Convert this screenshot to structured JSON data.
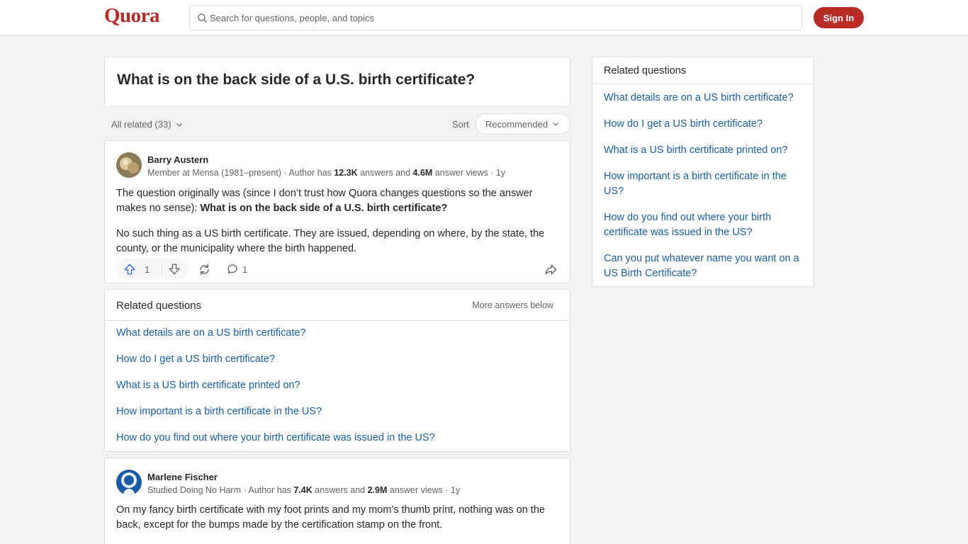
{
  "header": {
    "logo": "Quora",
    "search_placeholder": "Search for questions, people, and topics",
    "signin_label": "Sign In",
    "brand_color": "#b92b27"
  },
  "question": {
    "title": "What is on the back side of a U.S. birth certificate?"
  },
  "filters": {
    "all_related": "All related (33)",
    "sort_label": "Sort",
    "sort_value": "Recommended"
  },
  "answers": [
    {
      "author": "Barry Austern",
      "cred_prefix": "Member at Mensa (1981–present) · Author has ",
      "answers_count": "12.3K",
      "cred_mid": " answers and ",
      "views_count": "4.6M",
      "cred_suffix": " answer views · 1y",
      "para1_text": "The question originally was (since I don’t trust how Quora changes questions so the answer makes no sense): ",
      "para1_bold": "What is on the back side of a U.S. birth certificate?",
      "para2_text": "No such thing as a US birth certificate. They are issued, depending on where, by the state, the county, or the municipality where the birth happened.",
      "upvotes": "1",
      "comments": "1"
    },
    {
      "author": "Marlene Fischer",
      "cred_prefix": "Studied Doing No Harm · Author has ",
      "answers_count": "7.4K",
      "cred_mid": " answers and ",
      "views_count": "2.9M",
      "cred_suffix": " answer views · 1y",
      "para1_text": "On my fancy birth certificate with my foot prints and my mom’s thumb print, nothing was on the back, except for the bumps made by the certification stamp on the front."
    }
  ],
  "related_inline": {
    "title": "Related questions",
    "more": "More answers below",
    "items": [
      "What details are on a US birth certificate?",
      "How do I get a US birth certificate?",
      "What is a US birth certificate printed on?",
      "How important is a birth certificate in the US?",
      "How do you find out where your birth certificate was issued in the US?"
    ]
  },
  "sidebar": {
    "title": "Related questions",
    "items": [
      "What details are on a US birth certificate?",
      "How do I get a US birth certificate?",
      "What is a US birth certificate printed on?",
      "How important is a birth certificate in the US?",
      "How do you find out where your birth certificate was issued in the US?",
      "Can you put whatever name you want on a US Birth Certificate?"
    ]
  }
}
